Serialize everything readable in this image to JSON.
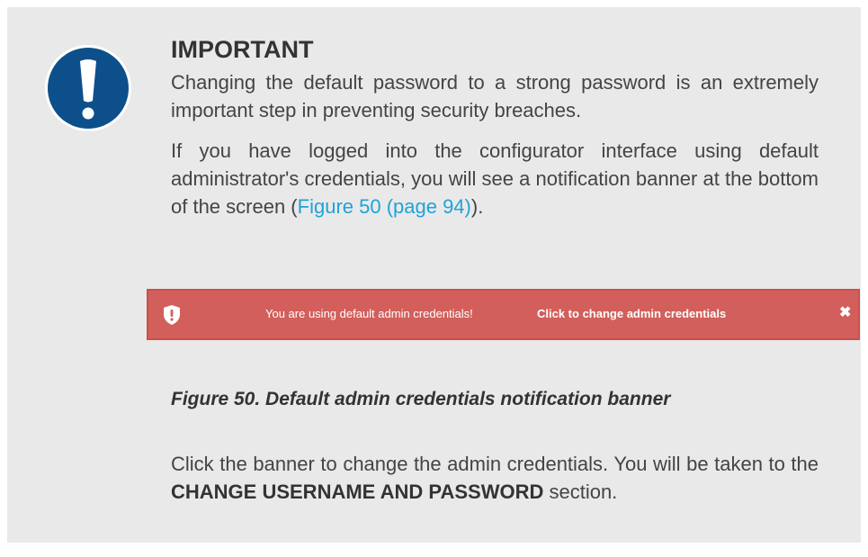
{
  "notice": {
    "heading": "IMPORTANT",
    "para1": "Changing the default password to a strong password is an extremely important step in preventing security breaches.",
    "para2_before": "If you have logged into the configurator interface using default administrator's credentials, you will see a notification banner at the bottom of the screen (",
    "para2_link": "Figure 50 (page 94)",
    "para2_after": ").",
    "icon": "exclamation-circle-icon",
    "icon_color": "#0d4f8b"
  },
  "banner": {
    "message": "You are using default admin credentials!",
    "action": "Click to change admin credentials",
    "close": "✖",
    "icon": "shield-exclamation-icon",
    "background": "#d25f5b"
  },
  "figure": {
    "caption": "Figure 50. Default admin credentials notification banner"
  },
  "instructions": {
    "text_before": "Click the banner to change the admin credentials. You will be taken to the ",
    "section_name": "CHANGE USERNAME AND PASSWORD",
    "text_after": " section."
  }
}
